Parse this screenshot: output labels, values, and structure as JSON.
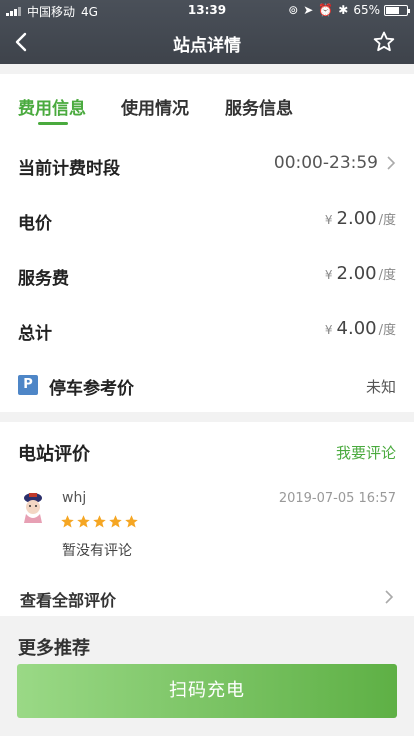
{
  "status_bar": {
    "carrier": "中国移动",
    "network": "4G",
    "time": "13:39",
    "battery": "65%",
    "battery_level": 0.65
  },
  "nav": {
    "title": "站点详情",
    "back_icon": "chevron-left-icon",
    "favorite_icon": "star-outline-icon"
  },
  "tabs": [
    {
      "label": "费用信息",
      "active": true
    },
    {
      "label": "使用情况",
      "active": false
    },
    {
      "label": "服务信息",
      "active": false
    }
  ],
  "fees": {
    "period": {
      "label": "当前计费时段",
      "value": "00:00-23:59"
    },
    "electricity": {
      "label": "电价",
      "currency": "¥",
      "value": "2.00",
      "unit": "/度"
    },
    "service": {
      "label": "服务费",
      "currency": "¥",
      "value": "2.00",
      "unit": "/度"
    },
    "total": {
      "label": "总计",
      "currency": "¥",
      "value": "4.00",
      "unit": "/度"
    },
    "parking": {
      "badge": "P",
      "label": "停车参考价",
      "value": "未知"
    }
  },
  "reviews": {
    "title": "电站评价",
    "action": "我要评论",
    "items": [
      {
        "name": "whj",
        "date": "2019-07-05 16:57",
        "rating": 5,
        "text": "暂没有评论"
      }
    ],
    "view_all": "查看全部评价"
  },
  "more": {
    "title": "更多推荐"
  },
  "scan_button": {
    "label": "扫码充电"
  },
  "colors": {
    "accent": "#4aaa3e",
    "header": "#454a52",
    "parking_badge": "#4e86c7",
    "star": "#f5a623"
  }
}
